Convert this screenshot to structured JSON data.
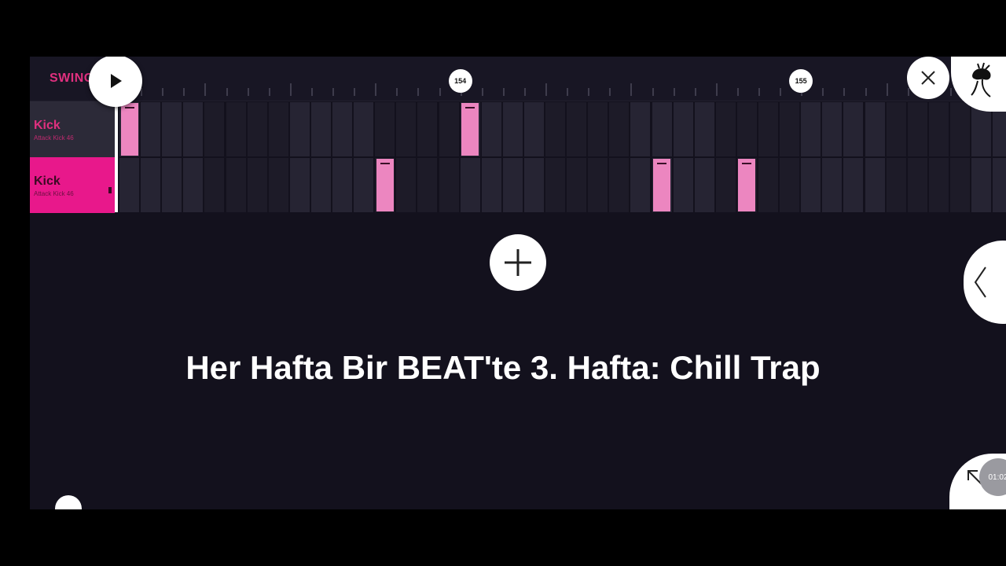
{
  "topbar": {
    "swing_label": "SWING",
    "bar_markers": [
      {
        "label": "154",
        "step": 16
      },
      {
        "label": "155",
        "step": 32
      }
    ]
  },
  "channels": [
    {
      "name": "Kick",
      "sample": "Attack Kick 46",
      "active": false,
      "notes": [
        0,
        16
      ]
    },
    {
      "name": "Kick",
      "sample": "Attack Kick 46",
      "active": true,
      "notes": [
        12,
        25,
        29
      ]
    }
  ],
  "step_count": 42,
  "caption": "Her Hafta Bir BEAT'te 3. Hafta: Chill Trap",
  "timer": "01:02",
  "icons": {
    "play": "play-icon",
    "close": "close-icon",
    "logo": "fl-studio-fruit-icon",
    "add": "plus-icon",
    "collapse": "chevron-left-icon",
    "expand": "arrow-up-left-icon"
  },
  "colors": {
    "accent": "#e8188b",
    "note": "#ec86c0",
    "background": "#13111d",
    "step_light": "#262433",
    "step_dark": "#1d1b28"
  }
}
